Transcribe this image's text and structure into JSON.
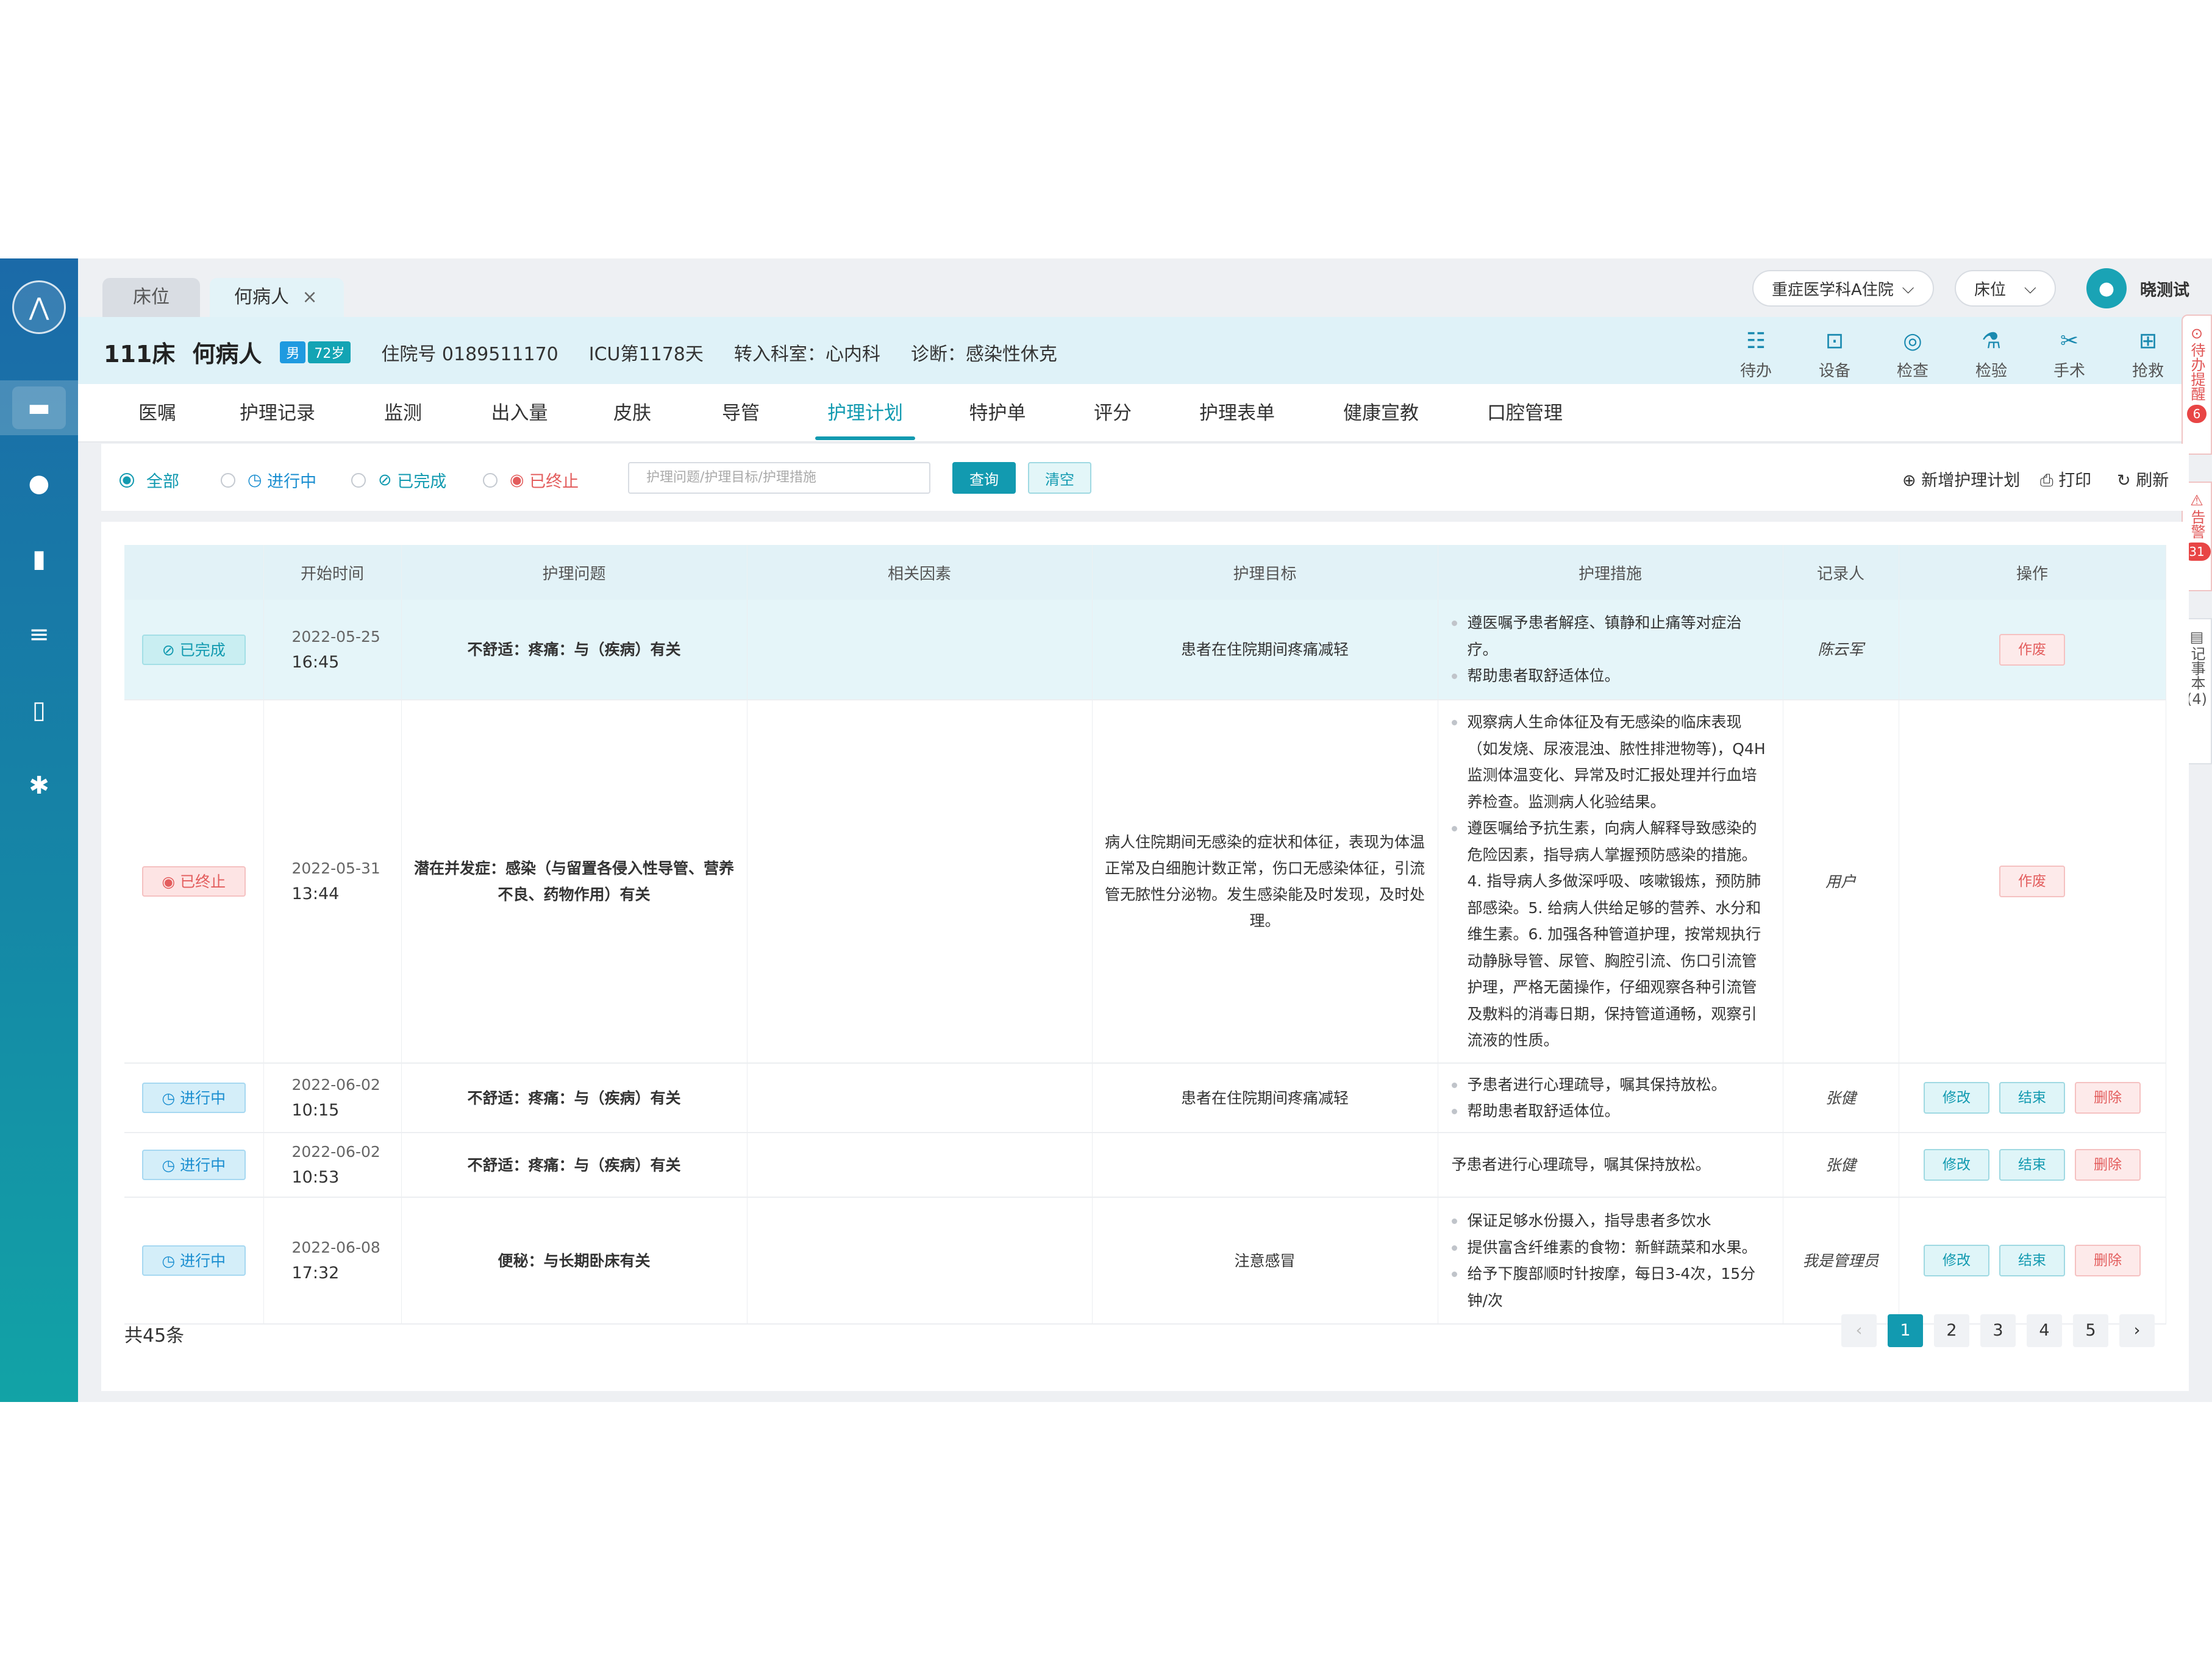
{
  "tabs": {
    "bed": "床位",
    "patient": "何病人",
    "close": "×"
  },
  "top_right": {
    "department": "重症医学科A住院",
    "bed_select": "床位",
    "user": "晓测试",
    "chevron": "⌵"
  },
  "patient": {
    "bed": "111床",
    "name": "何病人",
    "gender": "男",
    "age": "72岁",
    "admission_no": "住院号 0189511170",
    "icu_days": "ICU第1178天",
    "transfer": "转入科室：心内科",
    "diagnosis": "诊断：感染性休克"
  },
  "tools": [
    {
      "label": "待办",
      "icon": "todo-icon"
    },
    {
      "label": "设备",
      "icon": "device-icon"
    },
    {
      "label": "检查",
      "icon": "exam-icon"
    },
    {
      "label": "检验",
      "icon": "lab-icon"
    },
    {
      "label": "手术",
      "icon": "surgery-icon"
    },
    {
      "label": "抢救",
      "icon": "rescue-icon"
    }
  ],
  "menu": [
    "医嘱",
    "护理记录",
    "监测",
    "出入量",
    "皮肤",
    "导管",
    "护理计划",
    "特护单",
    "评分",
    "护理表单",
    "健康宣教",
    "口腔管理"
  ],
  "menu_active": "护理计划",
  "side_right": [
    {
      "label": "待办提醒",
      "count": "6"
    },
    {
      "label": "告警",
      "count": "31"
    },
    {
      "label": "记事本",
      "count": "(4)"
    }
  ],
  "filter": {
    "all": "全部",
    "running": "进行中",
    "done": "已完成",
    "stopped": "已终止",
    "search_placeholder": "护理问题/护理目标/护理措施",
    "query": "查询",
    "clear": "清空",
    "add": "新增护理计划",
    "print": "打印",
    "refresh": "刷新"
  },
  "table": {
    "headers": [
      "",
      "开始时间",
      "护理问题",
      "相关因素",
      "护理目标",
      "护理措施",
      "记录人",
      "操作"
    ],
    "rows": [
      {
        "status": "已完成",
        "date": "2022-05-25",
        "time": "16:45",
        "problem": "不舒适：疼痛：与（疾病）有关",
        "factor": "",
        "goal": "患者在住院期间疼痛减轻",
        "measures": [
          "遵医嘱予患者解痉、镇静和止痛等对症治疗。",
          "帮助患者取舒适体位。"
        ],
        "recorder": "陈云军",
        "ops": [
          "作废"
        ]
      },
      {
        "status": "已终止",
        "date": "2022-05-31",
        "time": "13:44",
        "problem": "潜在并发症：感染（与留置各侵入性导管、营养不良、药物作用）有关",
        "factor": "",
        "goal": "病人住院期间无感染的症状和体征，表现为体温正常及白细胞计数正常，伤口无感染体征，引流管无脓性分泌物。发生感染能及时发现，及时处理。",
        "measures": [
          "观察病人生命体征及有无感染的临床表现（如发烧、尿液混浊、脓性排泄物等)，Q4H监测体温变化、异常及时汇报处理并行血培养检查。监测病人化验结果。",
          "遵医嘱给予抗生素，向病人解释导致感染的危险因素，指导病人掌握预防感染的措施。4. 指导病人多做深呼吸、咳嗽锻炼，预防肺部感染。5. 给病人供给足够的营养、水分和维生素。6. 加强各种管道护理，按常规执行动静脉导管、尿管、胸腔引流、伤口引流管护理，严格无菌操作，仔细观察各种引流管及敷料的消毒日期，保持管道通畅，观察引流液的性质。"
        ],
        "recorder": "用户",
        "ops": [
          "作废"
        ]
      },
      {
        "status": "进行中",
        "date": "2022-06-02",
        "time": "10:15",
        "problem": "不舒适：疼痛：与（疾病）有关",
        "factor": "",
        "goal": "患者在住院期间疼痛减轻",
        "measures": [
          "予患者进行心理疏导，嘱其保持放松。",
          "帮助患者取舒适体位。"
        ],
        "recorder": "张健",
        "ops": [
          "修改",
          "结束",
          "删除"
        ]
      },
      {
        "status": "进行中",
        "date": "2022-06-02",
        "time": "10:53",
        "problem": "不舒适：疼痛：与（疾病）有关",
        "factor": "",
        "goal": "",
        "measures_plain": "予患者进行心理疏导，嘱其保持放松。",
        "recorder": "张健",
        "ops": [
          "修改",
          "结束",
          "删除"
        ]
      },
      {
        "status": "进行中",
        "date": "2022-06-08",
        "time": "17:32",
        "problem": "便秘：与长期卧床有关",
        "factor": "",
        "goal": "注意感冒",
        "measures": [
          "保证足够水份摄入，指导患者多饮水",
          "提供富含纤维素的食物：新鲜蔬菜和水果。",
          "给予下腹部顺时针按摩，每日3-4次，15分钟/次"
        ],
        "recorder": "我是管理员",
        "ops": [
          "修改",
          "结束",
          "删除"
        ]
      }
    ]
  },
  "footer": {
    "total": "共45条",
    "pages": [
      "1",
      "2",
      "3",
      "4",
      "5"
    ],
    "prev": "‹",
    "next": "›"
  }
}
